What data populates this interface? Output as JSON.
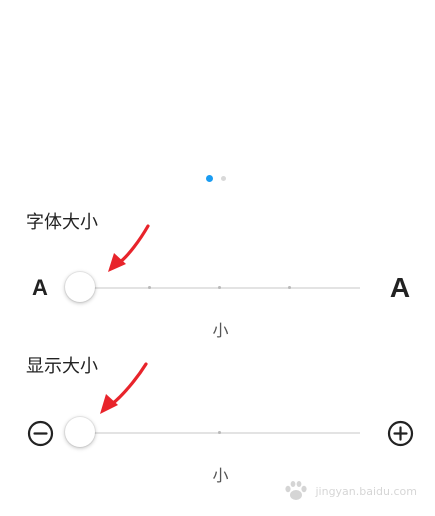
{
  "pager": {
    "active_index": 0,
    "count": 2,
    "colors": {
      "active": "#1a9cf2",
      "inactive": "#d9d9d9"
    }
  },
  "font_size": {
    "title": "字体大小",
    "small_icon_label": "A",
    "large_icon_label": "A",
    "value_label": "小",
    "level": 0,
    "levels": 5
  },
  "display_size": {
    "title": "显示大小",
    "decrease_icon": "minus-circle-icon",
    "increase_icon": "plus-circle-icon",
    "value_label": "小",
    "level": 0,
    "levels": 3
  },
  "annotations": {
    "arrow_color": "#e8242b"
  },
  "watermark": {
    "text": "jingyan.baidu.com"
  }
}
